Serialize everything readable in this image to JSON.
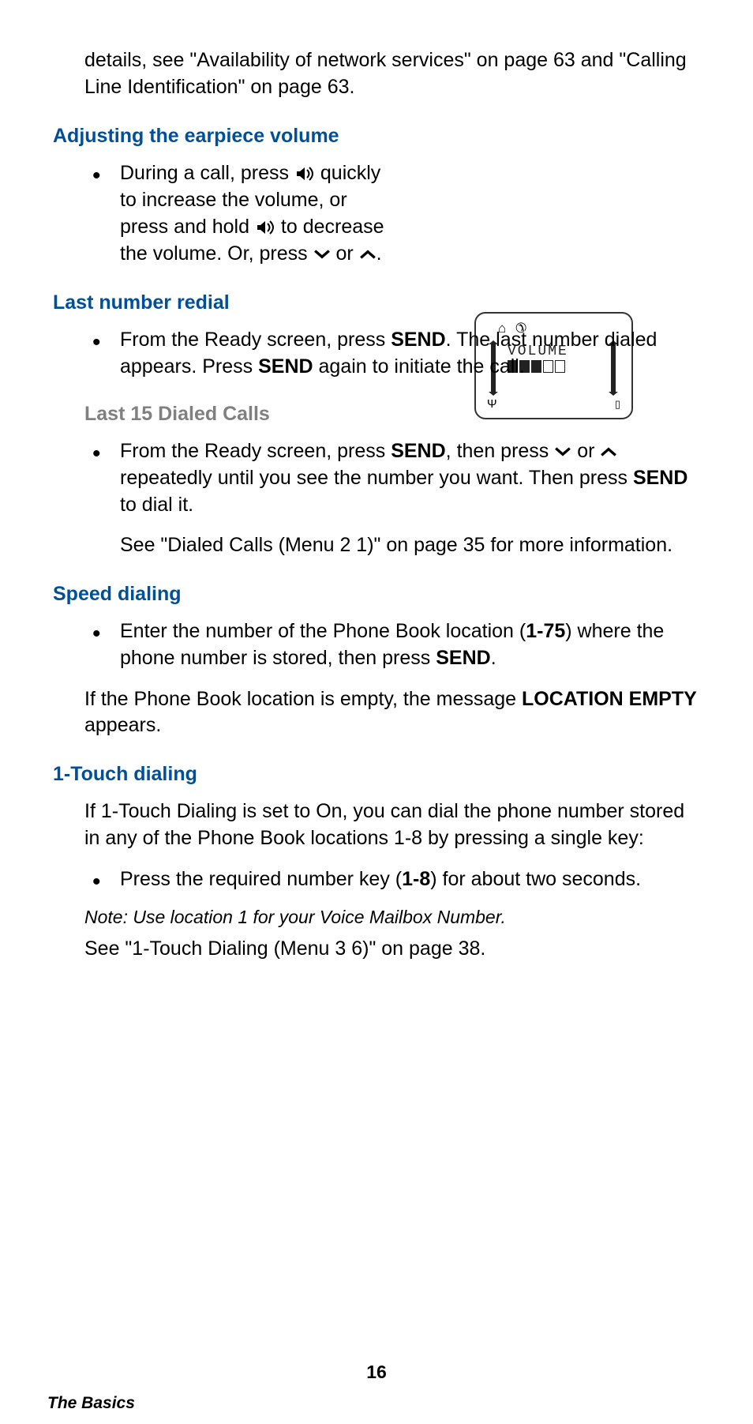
{
  "intro": "details, see \"Availability of network services\" on page 63 and \"Calling Line Identification\" on page 63.",
  "sections": {
    "volume": {
      "heading": "Adjusting the earpiece volume",
      "bullet_parts": {
        "p1": "During a call, press ",
        "p2": " quickly to increase the volume, or press and hold ",
        "p3": " to decrease the vol­ume. Or, press ",
        "p4": " or ",
        "p5": "."
      },
      "screen": {
        "label": "VOLUME",
        "filled_bars": 3,
        "empty_bars": 2
      }
    },
    "redial": {
      "heading": "Last number redial",
      "bullet": {
        "p1": "From the Ready screen, press ",
        "send1": "SEND",
        "p2": ". The last number dialed appears. Press ",
        "send2": "SEND",
        "p3": " again to initiate the call."
      }
    },
    "last15": {
      "heading": "Last 15 Dialed Calls",
      "bullet": {
        "p1": "From the Ready screen, press ",
        "send1": "SEND",
        "p2": ", then press ",
        "p3": " or ",
        "p4": " repeatedly until you see the number you want. Then press ",
        "send2": "SEND",
        "p5": " to dial it."
      },
      "extra": "See \"Dialed Calls (Menu 2 1)\" on page 35 for more information."
    },
    "speed": {
      "heading": "Speed dialing",
      "bullet": {
        "p1": "Enter the number of the Phone Book location (",
        "range": "1-75",
        "p2": ") where the phone number is stored, then press ",
        "send": "SEND",
        "p3": "."
      },
      "para": {
        "p1": "If the Phone Book location is empty, the message ",
        "loc": "LOCATION EMPTY",
        "p2": " appears."
      }
    },
    "touch": {
      "heading": "1-Touch dialing",
      "para1": "If 1-Touch Dialing is set to On, you can dial the phone number stored in any of the Phone Book locations 1-8 by pressing a single key:",
      "bullet": {
        "p1": "Press the required number key (",
        "range": "1-8",
        "p2": ") for about two seconds."
      },
      "note": "Note: Use location 1 for your Voice Mailbox Number.",
      "after": "See \"1-Touch Dialing (Menu 3 6)\" on page 38."
    }
  },
  "footer": {
    "page": "16",
    "title": "The Basics"
  },
  "icons": {
    "speaker": "speaker-icon",
    "down": "down-chevron-icon",
    "up": "up-chevron-icon"
  }
}
